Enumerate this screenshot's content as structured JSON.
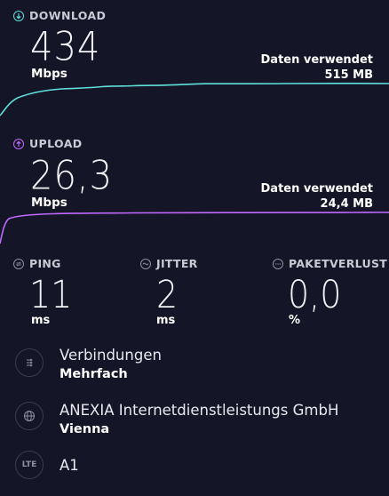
{
  "download": {
    "header": "DOWNLOAD",
    "value": "434",
    "unit": "Mbps",
    "data_used_label": "Daten verwendet",
    "data_used_value": "515 MB",
    "line_color": "#5fe0d8",
    "icon": "download-arrow-icon"
  },
  "upload": {
    "header": "UPLOAD",
    "value": "26,3",
    "unit": "Mbps",
    "data_used_label": "Daten verwendet",
    "data_used_value": "24,4 MB",
    "line_color": "#c069ff",
    "icon": "upload-arrow-icon"
  },
  "metrics": {
    "ping": {
      "label": "PING",
      "value": "11",
      "unit": "ms",
      "icon": "ping-icon"
    },
    "jitter": {
      "label": "JITTER",
      "value": "2",
      "unit": "ms",
      "icon": "jitter-icon"
    },
    "packet_loss": {
      "label": "PAKETVERLUST",
      "value": "0,0",
      "unit": "%",
      "icon": "packet-loss-icon"
    }
  },
  "connections": {
    "title": "Verbindungen",
    "value": "Mehrfach",
    "icon": "connections-icon"
  },
  "server": {
    "provider": "ANEXIA Internetdienstleistungs GmbH",
    "location": "Vienna",
    "icon": "globe-icon"
  },
  "network": {
    "badge": "LTE",
    "carrier": "A1",
    "icon": "lte-icon"
  }
}
